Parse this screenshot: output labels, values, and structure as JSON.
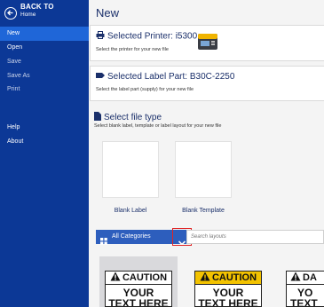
{
  "sidebar": {
    "back_title": "BACK TO",
    "back_sub": "Home",
    "items": [
      {
        "label": "New"
      },
      {
        "label": "Open"
      },
      {
        "label": "Save"
      },
      {
        "label": "Save As"
      },
      {
        "label": "Print"
      },
      {
        "label": "Help"
      },
      {
        "label": "About"
      }
    ]
  },
  "main": {
    "title": "New",
    "printer": {
      "heading": "Selected Printer: i5300",
      "description": "Select the printer for your new file"
    },
    "label_part": {
      "heading": "Selected Label Part: B30C-2250",
      "description": "Select the label part (supply) for your new file"
    },
    "file_type": {
      "heading": "Select file type",
      "description": "Select blank label, template or label layout for your new file",
      "tiles": [
        {
          "label": "Blank Label"
        },
        {
          "label": "Blank Template"
        }
      ]
    },
    "category": {
      "selected": "All Categories"
    },
    "search": {
      "placeholder": "Search layouts"
    },
    "layouts": [
      {
        "header": "CAUTION",
        "line1": "YOUR",
        "line2": "TEXT HERE"
      },
      {
        "header": "CAUTION",
        "line1": "YOUR",
        "line2": "TEXT HERE"
      },
      {
        "header": "DA",
        "line1": "YO",
        "line2": "TEXT"
      }
    ]
  },
  "colors": {
    "sidebar_bg": "#0c3896",
    "active_item": "#1f66d8",
    "category_bar": "#2d5ebd",
    "highlight": "#e02424",
    "caution_yellow": "#f2c200"
  }
}
